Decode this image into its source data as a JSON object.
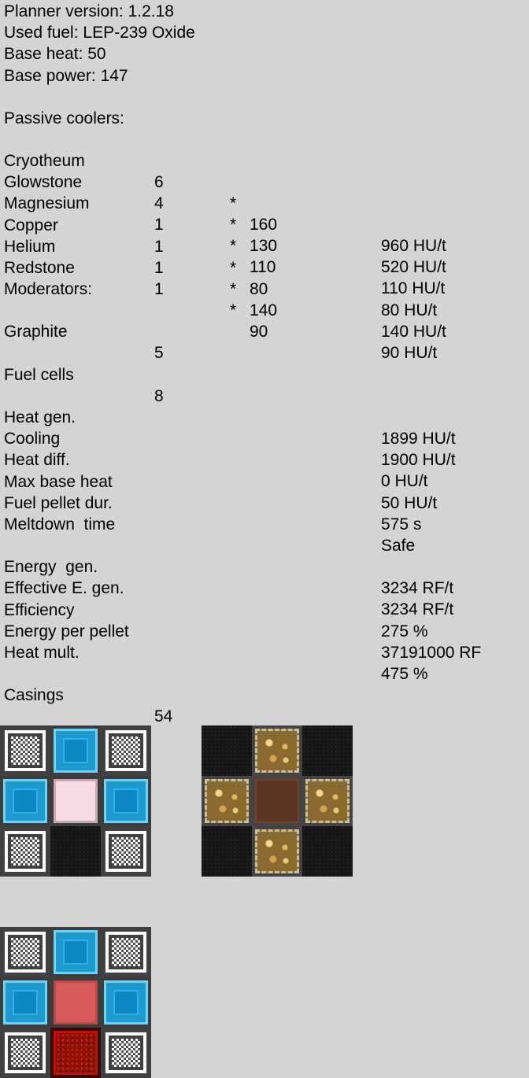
{
  "header": {
    "version": "Planner version: 1.2.18",
    "fuel": "Used fuel: LEP-239 Oxide",
    "base_heat": "Base heat: 50",
    "base_power": "Base power: 147"
  },
  "passive_coolers": {
    "title": "Passive coolers:",
    "rows": [
      {
        "name": "Cryotheum",
        "count": "6",
        "op": "*",
        "per": "160",
        "total": "960 HU/t"
      },
      {
        "name": "Glowstone",
        "count": "4",
        "op": "*",
        "per": "130",
        "total": "520 HU/t"
      },
      {
        "name": "Magnesium",
        "count": "1",
        "op": "*",
        "per": "110",
        "total": "110 HU/t"
      },
      {
        "name": "Copper",
        "count": "1",
        "op": "*",
        "per": "80",
        "total": "80 HU/t"
      },
      {
        "name": "Helium",
        "count": "1",
        "op": "*",
        "per": "140",
        "total": "140 HU/t"
      },
      {
        "name": "Redstone",
        "count": "1",
        "op": "*",
        "per": "90",
        "total": "90 HU/t"
      }
    ]
  },
  "moderators": {
    "title": "Moderators:",
    "rows": [
      {
        "name": "Graphite",
        "count": "5"
      }
    ]
  },
  "fuel_cells": {
    "label": "Fuel cells",
    "count": "8"
  },
  "heat_stats": [
    {
      "label": "Heat gen.",
      "value": "1899 HU/t"
    },
    {
      "label": "Cooling",
      "value": "1900 HU/t"
    },
    {
      "label": "Heat diff.",
      "value": "0 HU/t"
    },
    {
      "label": "Max base heat",
      "value": "50 HU/t"
    },
    {
      "label": "Fuel pellet dur.",
      "value": "575 s"
    },
    {
      "label": "Meltdown  time",
      "value": "Safe"
    }
  ],
  "energy_stats": [
    {
      "label": "Energy  gen.",
      "value": "3234 RF/t"
    },
    {
      "label": "Effective E. gen.",
      "value": "3234 RF/t"
    },
    {
      "label": "Efficiency",
      "value": "275 %"
    },
    {
      "label": "Energy per pellet",
      "value": "37191000 RF"
    },
    {
      "label": "Heat mult.",
      "value": "475 %"
    }
  ],
  "casings": {
    "label": "Casings",
    "count": "54"
  },
  "layers": [
    {
      "name": "layer-1",
      "cells": [
        "casing",
        "cryotheum",
        "casing",
        "cryotheum",
        "fuel-cell-pink",
        "cryotheum",
        "casing",
        "empty",
        "casing"
      ]
    },
    {
      "name": "layer-2",
      "cells": [
        "empty",
        "glowstone",
        "empty",
        "glowstone",
        "graphite",
        "glowstone",
        "empty",
        "glowstone",
        "empty"
      ]
    },
    {
      "name": "layer-3",
      "cells": [
        "casing",
        "cryotheum",
        "casing",
        "cryotheum",
        "fuel-cell-red",
        "cryotheum",
        "casing",
        "redstone",
        "casing"
      ]
    }
  ]
}
